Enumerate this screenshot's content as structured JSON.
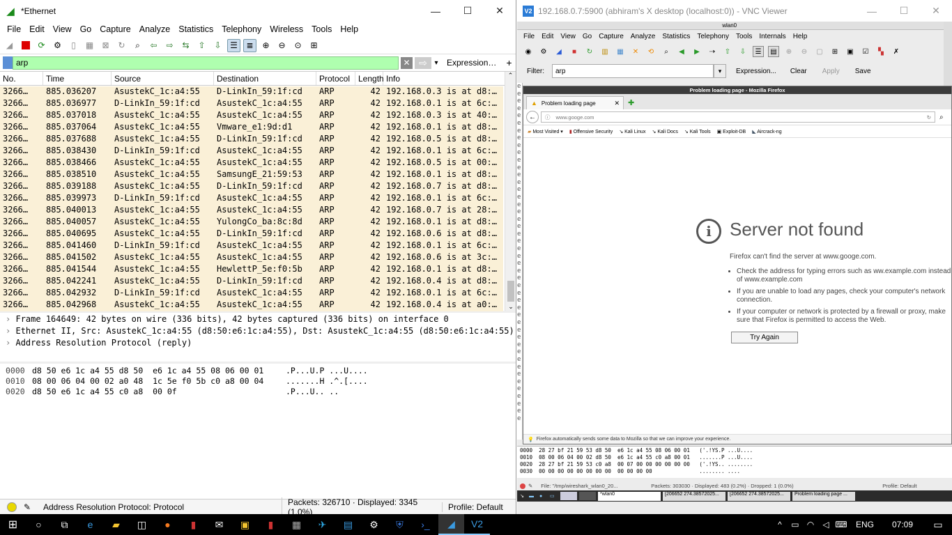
{
  "wireshark": {
    "title": "*Ethernet",
    "menu": [
      "File",
      "Edit",
      "View",
      "Go",
      "Capture",
      "Analyze",
      "Statistics",
      "Telephony",
      "Wireless",
      "Tools",
      "Help"
    ],
    "filter": {
      "value": "arp",
      "expression_label": "Expression…",
      "add_label": "+"
    },
    "columns": [
      "No.",
      "Time",
      "Source",
      "Destination",
      "Protocol",
      "Length",
      "Info"
    ],
    "packets": [
      [
        "3266…",
        "885.036207",
        "AsustekC_1c:a4:55",
        "D-LinkIn_59:1f:cd",
        "ARP",
        "42",
        "192.168.0.3 is at d8:…"
      ],
      [
        "3266…",
        "885.036977",
        "D-LinkIn_59:1f:cd",
        "AsustekC_1c:a4:55",
        "ARP",
        "42",
        "192.168.0.1 is at 6c:…"
      ],
      [
        "3266…",
        "885.037018",
        "AsustekC_1c:a4:55",
        "AsustekC_1c:a4:55",
        "ARP",
        "42",
        "192.168.0.3 is at 40:…"
      ],
      [
        "3266…",
        "885.037064",
        "AsustekC_1c:a4:55",
        "Vmware_e1:9d:d1",
        "ARP",
        "42",
        "192.168.0.1 is at d8:…"
      ],
      [
        "3266…",
        "885.037688",
        "AsustekC_1c:a4:55",
        "D-LinkIn_59:1f:cd",
        "ARP",
        "42",
        "192.168.0.5 is at d8:…"
      ],
      [
        "3266…",
        "885.038430",
        "D-LinkIn_59:1f:cd",
        "AsustekC_1c:a4:55",
        "ARP",
        "42",
        "192.168.0.1 is at 6c:…"
      ],
      [
        "3266…",
        "885.038466",
        "AsustekC_1c:a4:55",
        "AsustekC_1c:a4:55",
        "ARP",
        "42",
        "192.168.0.5 is at 00:…"
      ],
      [
        "3266…",
        "885.038510",
        "AsustekC_1c:a4:55",
        "SamsungE_21:59:53",
        "ARP",
        "42",
        "192.168.0.1 is at d8:…"
      ],
      [
        "3266…",
        "885.039188",
        "AsustekC_1c:a4:55",
        "D-LinkIn_59:1f:cd",
        "ARP",
        "42",
        "192.168.0.7 is at d8:…"
      ],
      [
        "3266…",
        "885.039973",
        "D-LinkIn_59:1f:cd",
        "AsustekC_1c:a4:55",
        "ARP",
        "42",
        "192.168.0.1 is at 6c:…"
      ],
      [
        "3266…",
        "885.040013",
        "AsustekC_1c:a4:55",
        "AsustekC_1c:a4:55",
        "ARP",
        "42",
        "192.168.0.7 is at 28:…"
      ],
      [
        "3266…",
        "885.040057",
        "AsustekC_1c:a4:55",
        "YulongCo_ba:8c:8d",
        "ARP",
        "42",
        "192.168.0.1 is at d8:…"
      ],
      [
        "3266…",
        "885.040695",
        "AsustekC_1c:a4:55",
        "D-LinkIn_59:1f:cd",
        "ARP",
        "42",
        "192.168.0.6 is at d8:…"
      ],
      [
        "3266…",
        "885.041460",
        "D-LinkIn_59:1f:cd",
        "AsustekC_1c:a4:55",
        "ARP",
        "42",
        "192.168.0.1 is at 6c:…"
      ],
      [
        "3266…",
        "885.041502",
        "AsustekC_1c:a4:55",
        "AsustekC_1c:a4:55",
        "ARP",
        "42",
        "192.168.0.6 is at 3c:…"
      ],
      [
        "3266…",
        "885.041544",
        "AsustekC_1c:a4:55",
        "HewlettP_5e:f0:5b",
        "ARP",
        "42",
        "192.168.0.1 is at d8:…"
      ],
      [
        "3266…",
        "885.042241",
        "AsustekC_1c:a4:55",
        "D-LinkIn_59:1f:cd",
        "ARP",
        "42",
        "192.168.0.4 is at d8:…"
      ],
      [
        "3266…",
        "885.042932",
        "D-LinkIn_59:1f:cd",
        "AsustekC_1c:a4:55",
        "ARP",
        "42",
        "192.168.0.1 is at 6c:…"
      ],
      [
        "3266…",
        "885.042968",
        "AsustekC_1c:a4:55",
        "AsustekC_1c:a4:55",
        "ARP",
        "42",
        "192.168.0.4 is at a0:…"
      ]
    ],
    "details": [
      "Frame 164649: 42 bytes on wire (336 bits), 42 bytes captured (336 bits) on interface 0",
      "Ethernet II, Src: AsustekC_1c:a4:55 (d8:50:e6:1c:a4:55), Dst: AsustekC_1c:a4:55 (d8:50:e6:1c:a4:55)",
      "Address Resolution Protocol (reply)"
    ],
    "hex": [
      {
        "off": "0000",
        "bytes": "d8 50 e6 1c a4 55 d8 50  e6 1c a4 55 08 06 00 01",
        "ascii": ".P...U.P ...U...."
      },
      {
        "off": "0010",
        "bytes": "08 00 06 04 00 02 a0 48  1c 5e f0 5b c0 a8 00 04",
        "ascii": ".......H .^.[...."
      },
      {
        "off": "0020",
        "bytes": "d8 50 e6 1c a4 55 c0 a8  00 0f",
        "ascii": ".P...U.. .."
      }
    ],
    "status": {
      "field": "Address Resolution Protocol: Protocol",
      "packets": "Packets: 326710 · Displayed: 3345 (1.0%)",
      "profile": "Profile: Default"
    }
  },
  "vnc": {
    "title": "192.168.0.7:5900 (abhiram's X desktop (localhost:0)) - VNC Viewer",
    "inner_title": "wlan0",
    "menu": [
      "File",
      "Edit",
      "View",
      "Go",
      "Capture",
      "Analyze",
      "Statistics",
      "Telephony",
      "Tools",
      "Internals",
      "Help"
    ],
    "filter": {
      "label": "Filter:",
      "value": "arp",
      "expression": "Expression...",
      "clear": "Clear",
      "apply": "Apply",
      "save": "Save"
    },
    "firefox": {
      "title": "Problem loading page - Mozilla Firefox",
      "tab": "Problem loading page",
      "url": "www.googe.com",
      "bookmarks": [
        "Most Visited",
        "Offensive Security",
        "Kali Linux",
        "Kali Docs",
        "Kali Tools",
        "Exploit-DB",
        "Aircrack-ng"
      ],
      "error_title": "Server not found",
      "error_line": "Firefox can't find the server at www.googe.com.",
      "bullets": [
        "Check the address for typing errors such as ww.example.com instead of www.example.com",
        "If you are unable to load any pages, check your computer's network connection.",
        "If your computer or network is protected by a firewall or proxy, make sure that Firefox is permitted to access the Web."
      ],
      "try_again": "Try Again",
      "notification": "Firefox automatically sends some data to Mozilla so that we can improve your experience."
    },
    "hex": [
      "0000  28 27 bf 21 59 53 d8 50  e6 1c a4 55 08 06 00 01   ('.!YS.P ...U....",
      "0010  08 00 06 04 00 02 d8 50  e6 1c a4 55 c0 a8 00 01   .......P ...U....",
      "0020  28 27 bf 21 59 53 c0 a8  00 07 00 00 00 00 00 00   ('.!YS.. ........",
      "0030  00 00 00 00 00 00 00 00  00 00 00 00               ........ ...."
    ],
    "status": {
      "file": "File: \"/tmp/wireshark_wlan0_20...",
      "packets": "Packets: 303030 · Displayed: 483 (0.2%) · Dropped: 1 (0.0%)",
      "profile": "Profile: Default"
    },
    "panel_tasks": [
      "*wlan0",
      "[206652 274.38572025...",
      "[206652 274.38572025...",
      "Problem loading page ..."
    ]
  },
  "taskbar": {
    "lang": "ENG",
    "time": "07:09"
  }
}
